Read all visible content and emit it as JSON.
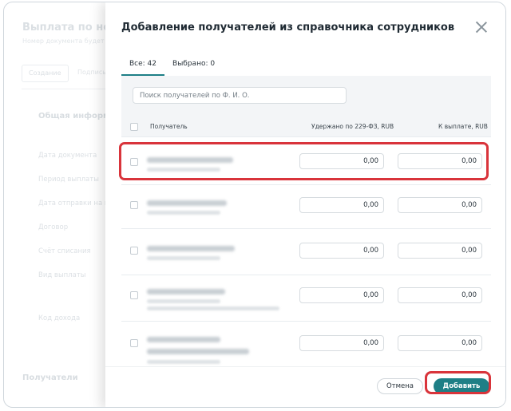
{
  "background": {
    "title": "Выплата по номе",
    "subtitle": "Номер документа будет к",
    "tabs": [
      "Создание",
      "Подпись"
    ],
    "section": "Общая информаци",
    "fields": [
      "Дата документа",
      "Период выплаты",
      "Дата отправки на ис",
      "Договор",
      "Счёт списания",
      "Вид выплаты",
      "Код дохода"
    ],
    "receivers": "Получатели"
  },
  "modal": {
    "title": "Добавление получателей из справочника сотрудников",
    "tabs": [
      {
        "label": "Все: 42",
        "active": true
      },
      {
        "label": "Выбрано: 0",
        "active": false
      }
    ],
    "search_placeholder": "Поиск получателей по Ф. И. О.",
    "columns": {
      "recipient": "Получатель",
      "withheld": "Удержано по 229-ФЗ, RUB",
      "payout": "К выплате, RUB"
    },
    "rows": [
      {
        "withheld": "0,00",
        "payout": "0,00"
      },
      {
        "withheld": "0,00",
        "payout": "0,00"
      },
      {
        "withheld": "0,00",
        "payout": "0,00"
      },
      {
        "withheld": "0,00",
        "payout": "0,00"
      },
      {
        "withheld": "0,00",
        "payout": "0,00"
      }
    ],
    "cancel_label": "Отмена",
    "add_label": "Добавить"
  },
  "colors": {
    "accent": "#1e7f86",
    "highlight": "#d9343b"
  }
}
